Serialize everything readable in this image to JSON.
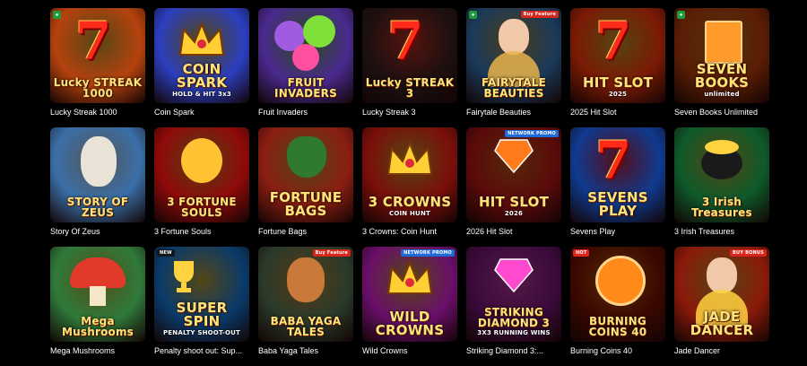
{
  "games": [
    [
      {
        "title": "Lucky Streak 1000",
        "logo": "Lucky STREAK 1000",
        "bg": "#b5420d",
        "accent": "#ffd23f",
        "badge": "",
        "icon": "seven"
      },
      {
        "title": "Coin Spark",
        "logo": "COIN SPARK",
        "sub": "HOLD & HIT 3x3",
        "bg": "#2b3fbf",
        "accent": "#ffcf33",
        "badge": "",
        "icon": "crown"
      },
      {
        "title": "Fruit Invaders",
        "logo": "FRUIT INVADERS",
        "bg": "#4a2a8f",
        "accent": "#7fe03a",
        "badge": "",
        "icon": "monster"
      },
      {
        "title": "Lucky Streak 3",
        "logo": "Lucky STREAK 3",
        "bg": "#1d1010",
        "accent": "#ff3b2a",
        "badge": "",
        "icon": "seven"
      },
      {
        "title": "Fairytale Beauties",
        "logo": "FAIRYTALE BEAUTIES",
        "bg": "#1a3a5a",
        "accent": "#e8b44c",
        "badge": "Buy Feature",
        "icon": "lady"
      },
      {
        "title": "2025 Hit Slot",
        "logo": "HIT SLOT",
        "sub": "2025",
        "bg": "#7a1a05",
        "accent": "#ffcf33",
        "badge": "",
        "icon": "seven"
      },
      {
        "title": "Seven Books Unlimited",
        "logo": "SEVEN BOOKS",
        "sub": "unlimited",
        "bg": "#5a1d05",
        "accent": "#ff9b2a",
        "badge": "",
        "icon": "book"
      }
    ],
    [
      {
        "title": "Story Of Zeus",
        "logo": "STORY OF ZEUS",
        "bg": "#3a6fa8",
        "accent": "#ffffff",
        "badge": "",
        "icon": "zeus"
      },
      {
        "title": "3 Fortune Souls",
        "logo": "3 FORTUNE SOULS",
        "bg": "#8f0a0a",
        "accent": "#ffc233",
        "badge": "",
        "icon": "cat"
      },
      {
        "title": "Fortune Bags",
        "logo": "FORTUNE BAGS",
        "bg": "#8a1e12",
        "accent": "#ffd23f",
        "badge": "",
        "icon": "bag"
      },
      {
        "title": "3 Crowns: Coin Hunt",
        "logo": "3 CROWNS",
        "sub": "COIN HUNT",
        "bg": "#7a0f0a",
        "accent": "#ffcf33",
        "badge": "",
        "icon": "crown"
      },
      {
        "title": "2026 Hit Slot",
        "logo": "HIT SLOT",
        "sub": "2026",
        "bg": "#5a0a0a",
        "accent": "#ff7a1a",
        "badge": "NETWORK PROMO",
        "icon": "gem"
      },
      {
        "title": "Sevens Play",
        "logo": "SEVENS PLAY",
        "bg": "#0f3a8f",
        "accent": "#ff2a4a",
        "badge": "",
        "icon": "seven"
      },
      {
        "title": "3 Irish Treasures",
        "logo": "3 Irish Treasures",
        "bg": "#0e5a2a",
        "accent": "#ffd23f",
        "badge": "",
        "icon": "pot"
      }
    ],
    [
      {
        "title": "Mega Mushrooms",
        "logo": "Mega Mushrooms",
        "bg": "#2f7a3a",
        "accent": "#ffe94a",
        "badge": "",
        "icon": "mushroom"
      },
      {
        "title": "Penalty shoot out: Sup...",
        "logo": "SUPER SPIN",
        "sub": "PENALTY SHOOT-OUT",
        "bg": "#0a3a6a",
        "accent": "#ffd23f",
        "badge": "NEW",
        "icon": "trophy"
      },
      {
        "title": "Baba Yaga Tales",
        "logo": "BABA YAGA TALES",
        "bg": "#2a3a2a",
        "accent": "#ffb347",
        "badge": "Buy Feature",
        "icon": "witch"
      },
      {
        "title": "Wild Crowns",
        "logo": "WILD CROWNS",
        "bg": "#6a0f6a",
        "accent": "#ffcf33",
        "badge": "NETWORK PROMO",
        "icon": "crown"
      },
      {
        "title": "Striking Diamond 3:...",
        "logo": "STRIKING DIAMOND 3",
        "sub": "3X3 RUNNING WINS",
        "bg": "#3a0a3a",
        "accent": "#ff4ad0",
        "badge": "",
        "icon": "gem"
      },
      {
        "title": "Burning Coins 40",
        "logo": "BURNING COINS 40",
        "bg": "#3a0800",
        "accent": "#ff8a1a",
        "badge": "HOT",
        "icon": "coin"
      },
      {
        "title": "Jade Dancer",
        "logo": "JADE DANCER",
        "bg": "#8a1a0a",
        "accent": "#ffd23f",
        "badge": "BUY BONUS",
        "icon": "lady"
      }
    ]
  ]
}
